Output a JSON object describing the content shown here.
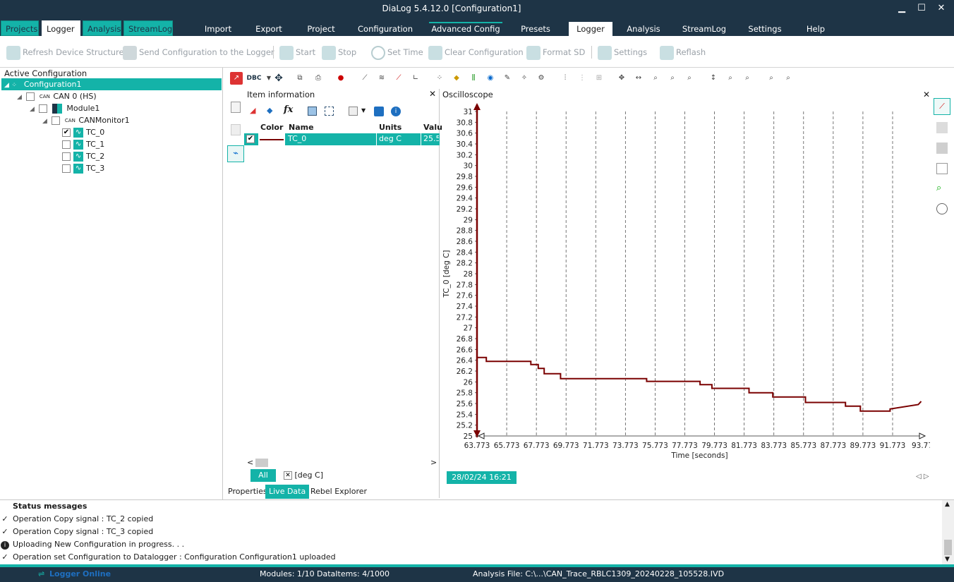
{
  "window": {
    "title": "DiaLog 5.4.12.0    [Configuration1]",
    "minimize": "▁",
    "maximize": "☐",
    "close": "✕"
  },
  "left_tabs": [
    {
      "label": "Projects",
      "active": false
    },
    {
      "label": "Logger",
      "active": true
    },
    {
      "label": "Analysis",
      "active": false
    },
    {
      "label": "StreamLog",
      "active": false
    }
  ],
  "menu_tabs": [
    {
      "label": "Import",
      "active": false
    },
    {
      "label": "Export",
      "active": false
    },
    {
      "label": "Project",
      "active": false
    },
    {
      "label": "Configuration",
      "active": false
    },
    {
      "label": "Advanced Config",
      "active": false
    },
    {
      "label": "Presets",
      "active": false
    },
    {
      "label": "Logger",
      "active": true
    },
    {
      "label": "Analysis",
      "active": false
    },
    {
      "label": "StreamLog",
      "active": false
    },
    {
      "label": "Settings",
      "active": false
    },
    {
      "label": "Help",
      "active": false
    }
  ],
  "ribbon": {
    "refresh": "Refresh Device Structure",
    "send": "Send Configuration to the Logger",
    "start": "Start",
    "stop": "Stop",
    "set_time": "Set Time",
    "clear": "Clear Configuration",
    "format": "Format SD",
    "settings": "Settings",
    "reflash": "Reflash"
  },
  "active_config": {
    "title": "Active Configuration",
    "root": "Configuration1",
    "can": "CAN 0 (HS)",
    "can_icon": "CAN",
    "module": "Module1",
    "monitor": "CANMonitor1",
    "signals": [
      {
        "name": "TC_0",
        "checked": true
      },
      {
        "name": "TC_1",
        "checked": false
      },
      {
        "name": "TC_2",
        "checked": false
      },
      {
        "name": "TC_3",
        "checked": false
      }
    ]
  },
  "toolbar2": {
    "dbc_label": "DBC"
  },
  "item_info": {
    "title": "Item information",
    "close": "✕",
    "fx": "fx",
    "headers": {
      "color": "Color",
      "name": "Name",
      "units": "Units",
      "value": "Valu"
    },
    "row": {
      "name": "TC_0",
      "units": "deg C",
      "value": "25.5",
      "color": "#7a0000"
    },
    "filter_all": "All",
    "filter_unit": "[deg C]",
    "scroll_left": "<",
    "scroll_right": ">"
  },
  "oscilloscope": {
    "title": "Oscilloscope",
    "close": "✕",
    "timestamp": "28/02/24 16:21",
    "nav": "◁ ▷"
  },
  "chart_data": {
    "type": "line",
    "xlabel": "Time [seconds]",
    "ylabel": "TC_0  [deg C]",
    "xlim": [
      63.773,
      93.77
    ],
    "ylim": [
      25,
      31
    ],
    "x_ticks": [
      "63.773",
      "65.773",
      "67.773",
      "69.773",
      "71.773",
      "73.773",
      "75.773",
      "77.773",
      "79.773",
      "81.773",
      "83.773",
      "85.773",
      "87.773",
      "89.773",
      "91.773",
      "93.77"
    ],
    "y_ticks": [
      "25",
      "25.2",
      "25.4",
      "25.6",
      "25.8",
      "26",
      "26.2",
      "26.4",
      "26.6",
      "26.8",
      "27",
      "27.2",
      "27.4",
      "27.6",
      "27.8",
      "28",
      "28.2",
      "28.4",
      "28.6",
      "28.8",
      "29",
      "29.2",
      "29.4",
      "29.6",
      "29.8",
      "30",
      "30.2",
      "30.4",
      "30.6",
      "30.8",
      "31"
    ],
    "grid": "vertical dashed",
    "series": [
      {
        "name": "TC_0",
        "color": "#7a0000",
        "x": [
          63.773,
          64.4,
          64.4,
          67.4,
          67.4,
          67.9,
          67.9,
          68.3,
          68.3,
          69.4,
          69.4,
          75.2,
          75.2,
          78.8,
          78.8,
          79.6,
          79.6,
          82.1,
          82.1,
          83.7,
          83.7,
          85.9,
          85.9,
          88.6,
          88.6,
          89.6,
          89.6,
          91.6,
          91.6,
          93.5,
          93.7
        ],
        "y": [
          26.45,
          26.45,
          26.38,
          26.38,
          26.32,
          26.32,
          26.25,
          26.25,
          26.15,
          26.15,
          26.06,
          26.06,
          26.01,
          26.01,
          25.95,
          25.95,
          25.88,
          25.88,
          25.8,
          25.8,
          25.72,
          25.72,
          25.62,
          25.62,
          25.55,
          25.55,
          25.46,
          25.46,
          25.5,
          25.58,
          25.64
        ]
      }
    ]
  },
  "bottom_tabs": [
    {
      "label": "Properties",
      "active": false
    },
    {
      "label": "Live Data",
      "active": true
    },
    {
      "label": "Rebel Explorer",
      "active": false
    }
  ],
  "status_messages": {
    "title": "Status messages",
    "items": [
      {
        "icon": "check",
        "text": "Operation Copy signal : TC_2 copied"
      },
      {
        "icon": "check",
        "text": "Operation Copy signal : TC_3 copied"
      },
      {
        "icon": "info",
        "text": "Uploading New Configuration in progress. . ."
      },
      {
        "icon": "check",
        "text": "Operation set Configuration to Datalogger : Configuration Configuration1 uploaded"
      }
    ]
  },
  "status_bar": {
    "logger": "Logger Online",
    "modules": "Modules: 1/10",
    "dataitems": "DataItems: 4/1000",
    "analysis_file": "Analysis File: C:\\...\\CAN_Trace_RBLC1309_20240228_105528.IVD"
  }
}
